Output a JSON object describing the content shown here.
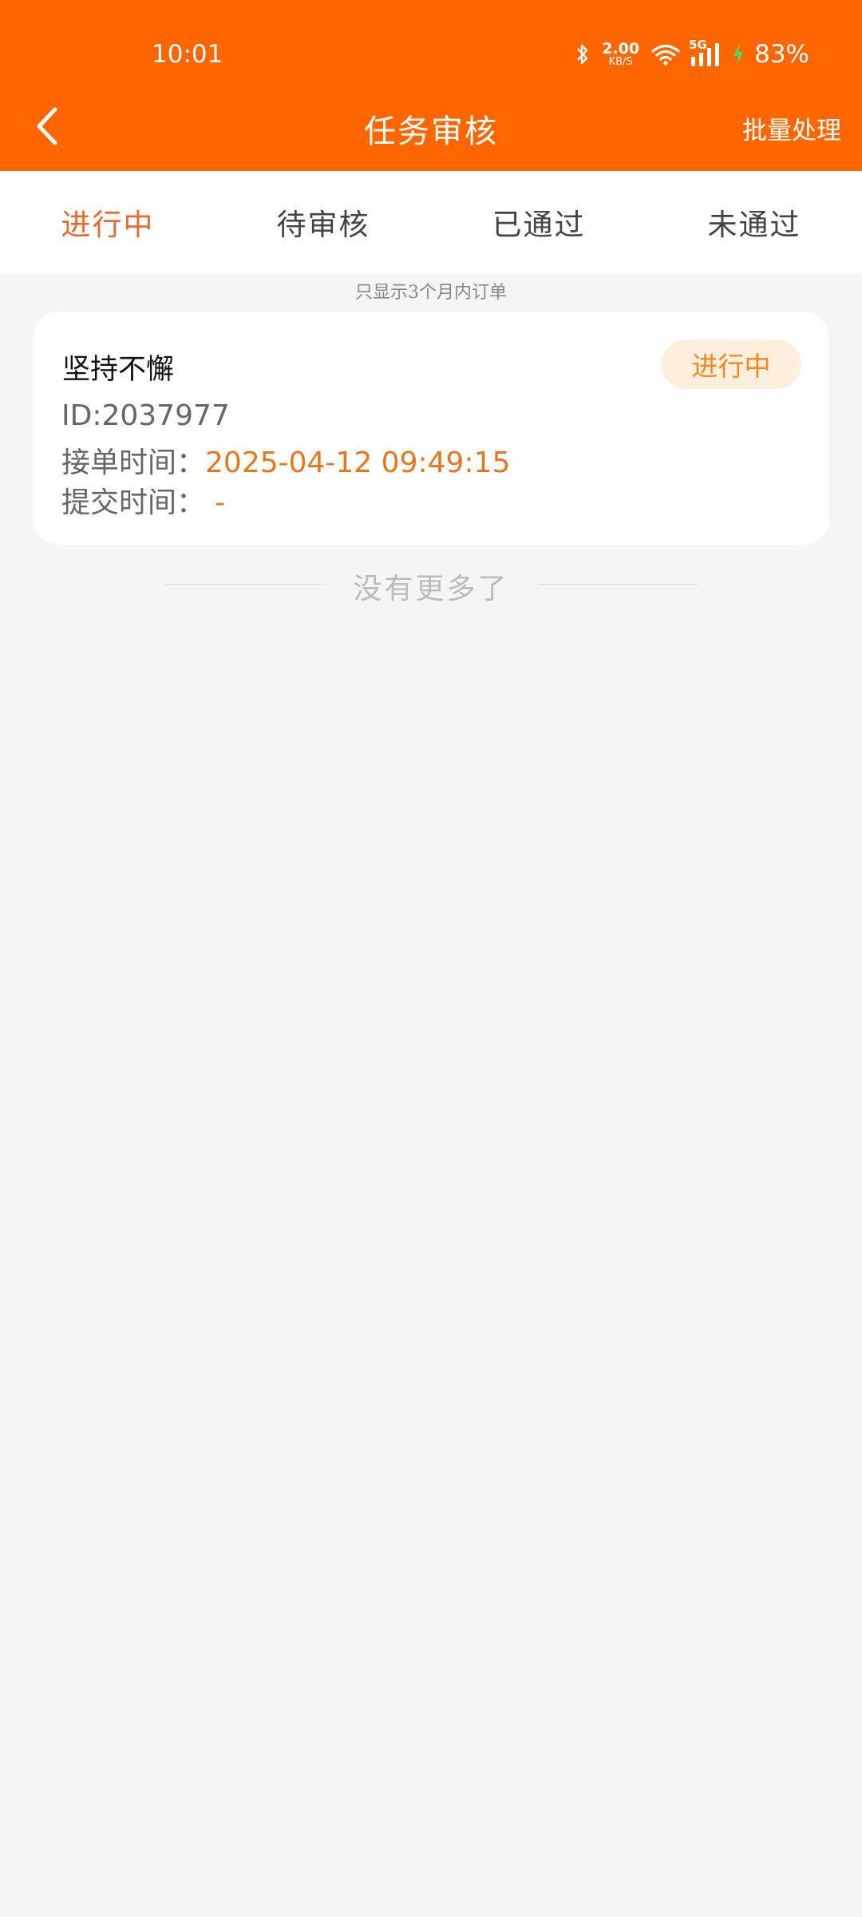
{
  "status_bar": {
    "time": "10:01",
    "net_speed_value": "2.00",
    "net_speed_unit": "KB/S",
    "network_type": "5G",
    "battery": "83%"
  },
  "nav": {
    "title": "任务审核",
    "action": "批量处理"
  },
  "tabs": [
    {
      "label": "进行中",
      "active": true
    },
    {
      "label": "待审核",
      "active": false
    },
    {
      "label": "已通过",
      "active": false
    },
    {
      "label": "未通过",
      "active": false
    }
  ],
  "hint": "只显示3个月内订单",
  "task": {
    "title": "坚持不懈",
    "status": "进行中",
    "id": "ID:2037977",
    "accept_label": "接单时间：",
    "accept_time": "2025-04-12 09:49:15",
    "submit_label": "提交时间：",
    "submit_time": "-"
  },
  "footer_text": "没有更多了",
  "colors": {
    "header": "#ff6600",
    "active_tab": "#e8692b",
    "badge_bg": "#feeedd",
    "badge_text": "#f08a1c",
    "value_text": "#e8761f"
  }
}
